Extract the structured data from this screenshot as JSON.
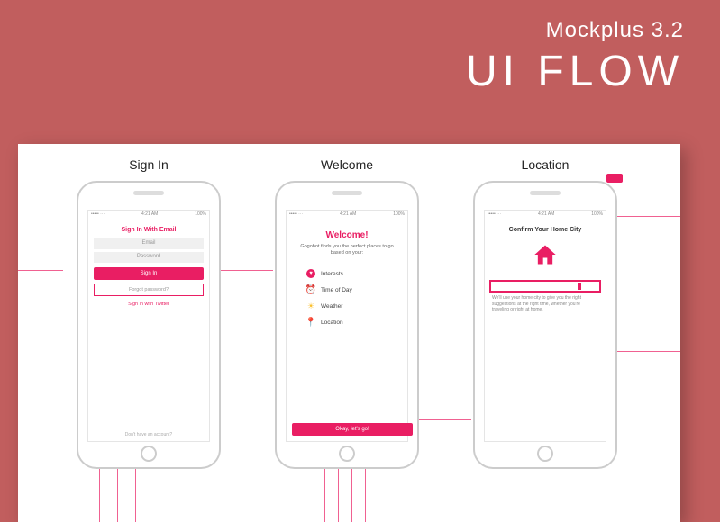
{
  "header": {
    "brand": "Mockplus 3.2",
    "title": "UI FLOW"
  },
  "screens": {
    "signin": {
      "caption": "Sign In",
      "status": {
        "left": "••••• ⋯",
        "center": "4:21 AM",
        "right": "100%"
      },
      "heading": "Sign In With Email",
      "field_email": "Email",
      "field_password": "Password",
      "btn_signin": "Sign In",
      "forgot": "Forgot password?",
      "twitter": "Sign in with Twitter",
      "footer": "Don't have an account?"
    },
    "welcome": {
      "caption": "Welcome",
      "status": {
        "left": "••••• ⋯",
        "center": "4:21 AM",
        "right": "100%"
      },
      "heading": "Welcome!",
      "desc": "Gogobot finds you the perfect places to go based on your:",
      "feat1": "Interests",
      "feat2": "Time of Day",
      "feat3": "Weather",
      "feat4": "Location",
      "btn_next": "Okay, let's go!"
    },
    "location": {
      "caption": "Location",
      "status": {
        "left": "••••• ⋯",
        "center": "4:21 AM",
        "right": "100%"
      },
      "heading": "Confirm Your Home City",
      "desc": "We'll use your home city to give you the right suggestions at the right time, whether you're traveling or right at home."
    }
  }
}
